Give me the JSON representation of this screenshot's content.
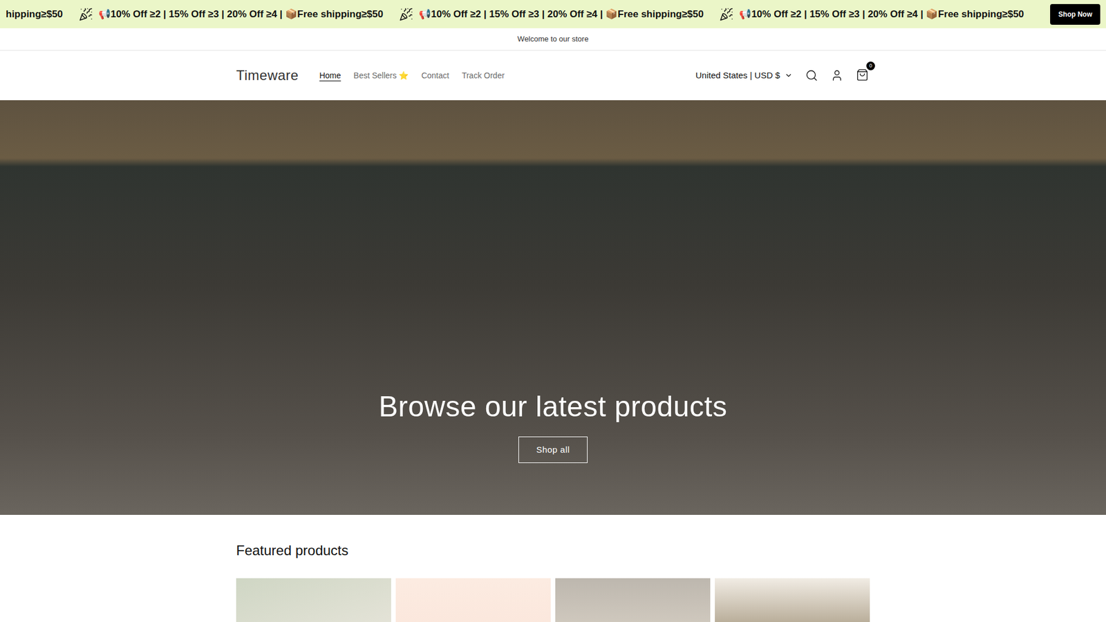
{
  "announcement_bar": {
    "lead_text": "hipping≥$50",
    "messages": [
      "📢10% Off ≥2 | 15% Off ≥3 | 20% Off ≥4 | 📦Free shipping≥$50",
      "📢10% Off ≥2 | 15% Off ≥3 | 20% Off ≥4 | 📦Free shipping≥$50",
      "📢10% Off ≥2 | 15% Off ≥3 | 20% Off ≥4 | 📦Free shipping≥$50"
    ],
    "button": "Shop Now"
  },
  "welcome": "Welcome to our store",
  "header": {
    "logo": "Timeware",
    "nav": [
      {
        "label": "Home",
        "selected": true
      },
      {
        "label": "Best Sellers ⭐",
        "selected": false
      },
      {
        "label": "Contact",
        "selected": false
      },
      {
        "label": "Track Order",
        "selected": false
      }
    ],
    "locale": "United States | USD $",
    "cart_count": "0"
  },
  "hero": {
    "title": "Browse our latest products",
    "button": "Shop all"
  },
  "featured": {
    "title": "Featured products"
  }
}
